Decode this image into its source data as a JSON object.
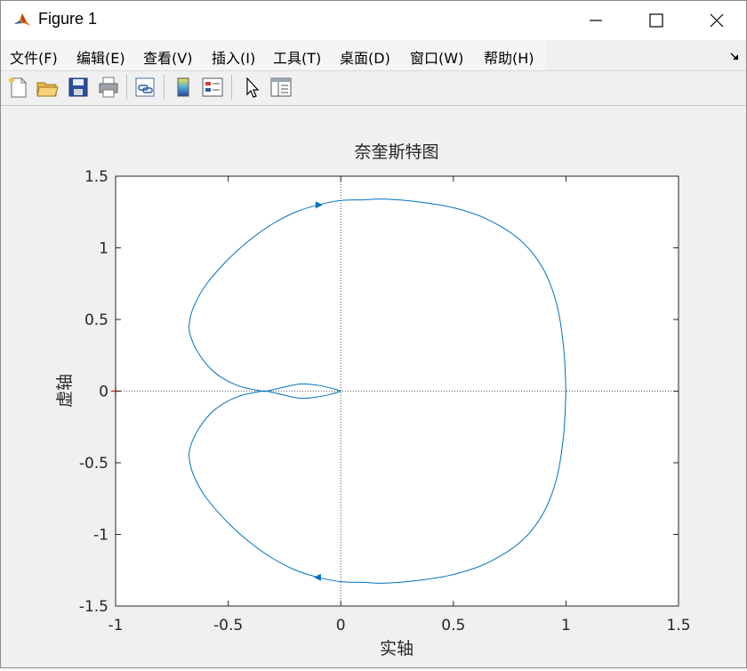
{
  "window": {
    "title": "Figure 1"
  },
  "menu": {
    "items": [
      "文件(F)",
      "编辑(E)",
      "查看(V)",
      "插入(I)",
      "工具(T)",
      "桌面(D)",
      "窗口(W)",
      "帮助(H)"
    ]
  },
  "toolbar": {
    "buttons": [
      "new-figure-icon",
      "open-file-icon",
      "save-icon",
      "print-icon",
      "link-plot-icon",
      "colorbar-icon",
      "legend-icon",
      "edit-plot-icon",
      "property-inspector-icon"
    ]
  },
  "colors": {
    "curve": "#0072bd",
    "critical_point": "#ff0000",
    "axis": "#262626",
    "guide": "#262626"
  },
  "chart_data": {
    "type": "line",
    "title": "奈奎斯特图",
    "xlabel": "实轴",
    "ylabel": "虚轴",
    "xlim": [
      -1,
      1.5
    ],
    "ylim": [
      -1.5,
      1.5
    ],
    "xticks": [
      -1,
      -0.5,
      0,
      0.5,
      1,
      1.5
    ],
    "xtick_labels": [
      "-1",
      "-0.5",
      "0",
      "0.5",
      "1",
      "1.5"
    ],
    "yticks": [
      -1.5,
      -1,
      -0.5,
      0,
      0.5,
      1,
      1.5
    ],
    "ytick_labels": [
      "-1.5",
      "-1",
      "-0.5",
      "0",
      "0.5",
      "1",
      "1.5"
    ],
    "grid": false,
    "critical_point": [
      -1,
      0
    ],
    "series": [
      {
        "x": [
          1.0,
          0.99,
          0.96,
          0.9,
          0.8,
          0.65,
          0.5,
          0.35,
          0.2,
          0.1,
          0.0,
          -0.1,
          -0.2,
          -0.3,
          -0.4,
          -0.5,
          -0.6,
          -0.65,
          -0.67,
          -0.67,
          -0.63,
          -0.56,
          -0.46,
          -0.36,
          -0.33,
          -0.26,
          -0.18,
          -0.1,
          -0.04,
          0.0
        ],
        "y": [
          0.0,
          0.3,
          0.6,
          0.85,
          1.05,
          1.2,
          1.28,
          1.32,
          1.34,
          1.335,
          1.33,
          1.3,
          1.25,
          1.17,
          1.06,
          0.92,
          0.74,
          0.6,
          0.5,
          0.4,
          0.26,
          0.13,
          0.04,
          0.003,
          0.0,
          0.025,
          0.05,
          0.04,
          0.02,
          0.0
        ]
      },
      {
        "x": [
          1.0,
          0.99,
          0.96,
          0.9,
          0.8,
          0.65,
          0.5,
          0.35,
          0.2,
          0.1,
          0.0,
          -0.1,
          -0.2,
          -0.3,
          -0.4,
          -0.5,
          -0.6,
          -0.65,
          -0.67,
          -0.67,
          -0.63,
          -0.56,
          -0.46,
          -0.36,
          -0.33,
          -0.26,
          -0.18,
          -0.1,
          -0.04,
          0.0
        ],
        "y": [
          0.0,
          -0.3,
          -0.6,
          -0.85,
          -1.05,
          -1.2,
          -1.28,
          -1.32,
          -1.34,
          -1.335,
          -1.33,
          -1.3,
          -1.25,
          -1.17,
          -1.06,
          -0.92,
          -0.74,
          -0.6,
          -0.5,
          -0.4,
          -0.26,
          -0.13,
          -0.04,
          -0.003,
          0.0,
          -0.025,
          -0.05,
          -0.04,
          -0.02,
          0.0
        ]
      }
    ],
    "arrows": [
      {
        "x": -0.1,
        "y": 1.3,
        "direction": "right"
      },
      {
        "x": -0.1,
        "y": -1.3,
        "direction": "left"
      }
    ]
  }
}
